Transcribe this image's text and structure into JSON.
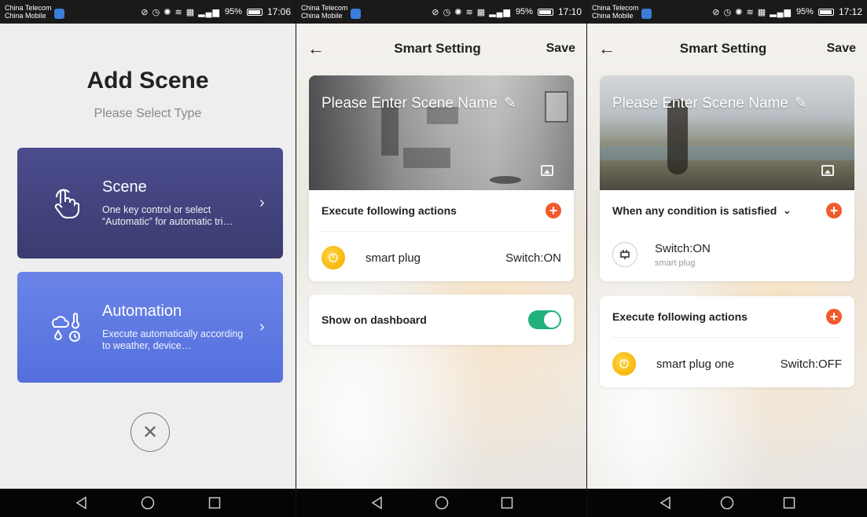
{
  "status": {
    "carrier1": "China Telecom",
    "carrier2": "China Mobile",
    "battery": "95%",
    "time1": "17:06",
    "time2": "17:10",
    "time3": "17:12"
  },
  "screen1": {
    "title": "Add Scene",
    "subtitle": "Please Select Type",
    "scene": {
      "title": "Scene",
      "desc": "One key control or select “Automatic” for automatic tri…",
      "icon": "tap-hand-icon",
      "color": "#46478a"
    },
    "automation": {
      "title": "Automation",
      "desc": "Execute automatically according to weather, device…",
      "icon": "weather-icon",
      "color": "#5f7be4"
    }
  },
  "screen2": {
    "top_title": "Smart Setting",
    "save": "Save",
    "scene_name_placeholder": "Please Enter Scene Name",
    "actions_header": "Execute following actions",
    "action": {
      "name": "smart plug",
      "value": "Switch:ON"
    },
    "dashboard_label": "Show on dashboard",
    "dashboard_on": true
  },
  "screen3": {
    "top_title": "Smart Setting",
    "save": "Save",
    "scene_name_placeholder": "Please Enter Scene Name",
    "condition_header": "When any condition is satisfied",
    "condition": {
      "title": "Switch:ON",
      "subtitle": "smart plug"
    },
    "actions_header": "Execute following actions",
    "action": {
      "name": "smart plug one",
      "value": "Switch:OFF"
    }
  },
  "colors": {
    "accent": "#f15a2b",
    "toggle_on": "#20b27a"
  }
}
